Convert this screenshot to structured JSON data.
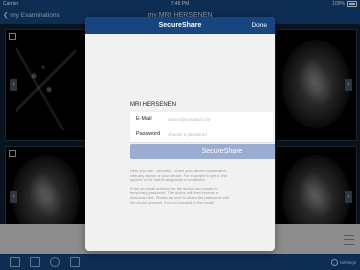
{
  "status_bar": {
    "carrier": "Carrier",
    "time": "7:48 PM",
    "battery": "100%"
  },
  "nav": {
    "back_label": "my Examinations",
    "title": "my MRI HERSENEN"
  },
  "tab_bar": {
    "settings_label": "Settings"
  },
  "modal": {
    "title": "SecureShare",
    "done_label": "Done",
    "study_name": "MRI HERSENEN",
    "email": {
      "label": "E-Mail",
      "placeholder": "doctor@hospital.com",
      "value": ""
    },
    "password": {
      "label": "Password",
      "placeholder": "choose a password",
      "value": ""
    },
    "share_button": "SecureShare",
    "info": [
      "Here you can - securely - share your above examination with any doctor of your choice. For example to get a 2nd opinion or for further diagnosis or treatment.",
      "Enter an email address for the doctor and create a temporary password. The doctor will then receive a download link. Please be sure to share the password with the doctor yourself. It is not included in the email!"
    ]
  },
  "colors": {
    "brand_blue": "#16457f",
    "button_disabled": "#9aacd0",
    "modal_bg": "#f1f1f2"
  }
}
